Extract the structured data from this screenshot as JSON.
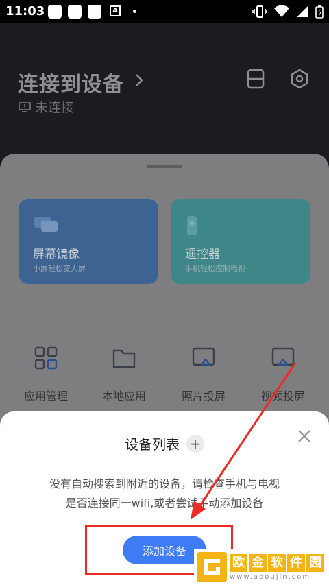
{
  "status_bar": {
    "time": "11:03",
    "notif_a_letter": "A",
    "icons": [
      "vibrate-icon",
      "wifi-icon",
      "cellular-icon",
      "battery-icon"
    ]
  },
  "header": {
    "title": "连接到设备",
    "connection_status": "未连接",
    "icons": [
      "chevron-right-icon",
      "tv-disconnected-icon",
      "device-switch-icon",
      "settings-icon"
    ]
  },
  "cards": [
    {
      "title": "屏幕镜像",
      "subtitle": "小屏轻松变大屏",
      "color": "#3d6393"
    },
    {
      "title": "遥控器",
      "subtitle": "手机轻松控制电视",
      "color": "#3f8689"
    }
  ],
  "grid": [
    {
      "label": "应用管理",
      "icon": "apps-grid-icon"
    },
    {
      "label": "本地应用",
      "icon": "folder-icon"
    },
    {
      "label": "照片投屏",
      "icon": "photo-cast-icon"
    },
    {
      "label": "视频投屏",
      "icon": "video-cast-icon"
    }
  ],
  "dialog": {
    "title": "设备列表",
    "plus_label": "+",
    "message_line1": "没有自动搜索到附近的设备，请检查手机与电视",
    "message_line2": "是否连接同一wifi,或者尝试手动添加设备",
    "add_button": "添加设备"
  },
  "watermark": {
    "name_chars": [
      "欧",
      "金",
      "软",
      "件",
      "园"
    ],
    "url": "www.apoujin.com"
  },
  "colors": {
    "accent": "#3d7cf5",
    "annotation": "#ee2a24",
    "watermark": "#f2b515"
  }
}
